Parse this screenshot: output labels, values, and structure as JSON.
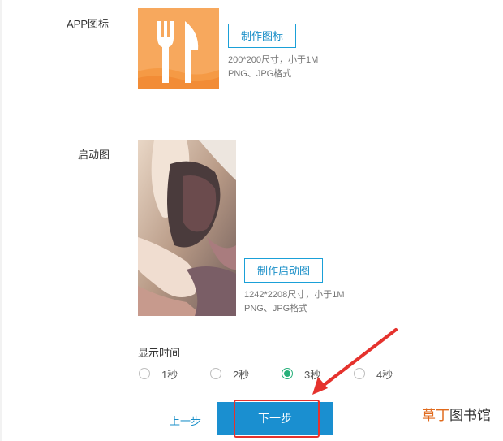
{
  "app_icon": {
    "label": "APP图标",
    "button_label": "制作图标",
    "hint_size": "200*200尺寸，小于1M",
    "hint_format": "PNG、JPG格式",
    "icon_name": "fork-knife-icon",
    "background_color": "#f7a85d"
  },
  "launch_image": {
    "label": "启动图",
    "button_label": "制作启动图",
    "hint_size": "1242*2208尺寸，小于1M",
    "hint_format": "PNG、JPG格式"
  },
  "display_time": {
    "label": "显示时间",
    "options": [
      "1秒",
      "2秒",
      "3秒",
      "4秒"
    ],
    "selected": "3秒"
  },
  "navigation": {
    "prev_label": "上一步",
    "next_label": "下一步"
  },
  "watermark": {
    "accent": "草丁",
    "rest": "图书馆"
  },
  "colors": {
    "accent": "#1a8fd0",
    "radio_checked": "#27b07a",
    "annotation": "#e5322d"
  }
}
